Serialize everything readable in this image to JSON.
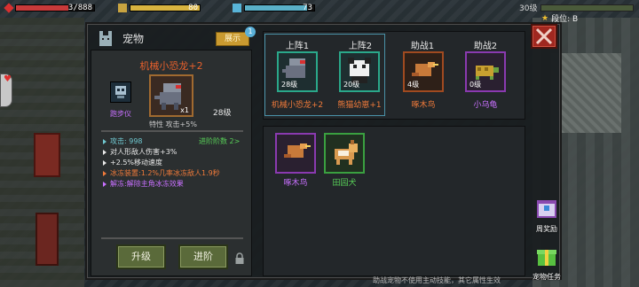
{
  "stats": {
    "hp": {
      "value": "3/888",
      "fill": 0.67
    },
    "armor": {
      "value": "80",
      "fill": 1.0
    },
    "energy": {
      "value": "73",
      "fill": 0.9
    }
  },
  "player": {
    "level_label": "30级",
    "rank_label": "段位: B"
  },
  "pet_panel": {
    "tab_title": "宠物",
    "display_button": "展示",
    "display_badge": "1",
    "selected_pet": {
      "name": "机械小恐龙+2",
      "skill_label": "跑步仪",
      "count": "x1",
      "level": "28级",
      "trait": "特性 攻击+5%"
    },
    "advance_hint": "进阶阶数 2>",
    "attributes": [
      {
        "text": "攻击: 998",
        "kind": "atk"
      },
      {
        "text": "对人形敌人伤害+3%",
        "kind": "std"
      },
      {
        "text": "+2.5%移动速度",
        "kind": "std"
      },
      {
        "text": "冰冻装置:1.2%几率冰冻敌人1.9秒",
        "kind": "frost"
      },
      {
        "text": "解冻:解除主角冰冻效果",
        "kind": "unfreeze"
      }
    ],
    "upgrade_button": "升级",
    "advance_button": "进阶"
  },
  "slots": [
    {
      "title": "上阵1",
      "name": "机械小恐龙+2",
      "level": "28级",
      "name_color": "#f07a3a",
      "frame": "green"
    },
    {
      "title": "上阵2",
      "name": "熊猫幼崽+1",
      "level": "20级",
      "name_color": "#f07a3a",
      "frame": "green"
    },
    {
      "title": "助战1",
      "name": "啄木鸟",
      "level": "4级",
      "name_color": "#f07a3a",
      "frame": "orange"
    },
    {
      "title": "助战2",
      "name": "小乌龟",
      "level": "0级",
      "name_color": "#c870ff",
      "frame": "purple"
    }
  ],
  "bench": [
    {
      "name": "啄木鸟",
      "name_color": "#c870ff",
      "frame": "purple"
    },
    {
      "name": "田园犬",
      "name_color": "#58d058",
      "frame": "green"
    }
  ],
  "footer_note": "助战宠物不使用主动技能，其它属性生效",
  "rewards": {
    "weekly": "周奖励",
    "pet_task": "宠物任务"
  }
}
